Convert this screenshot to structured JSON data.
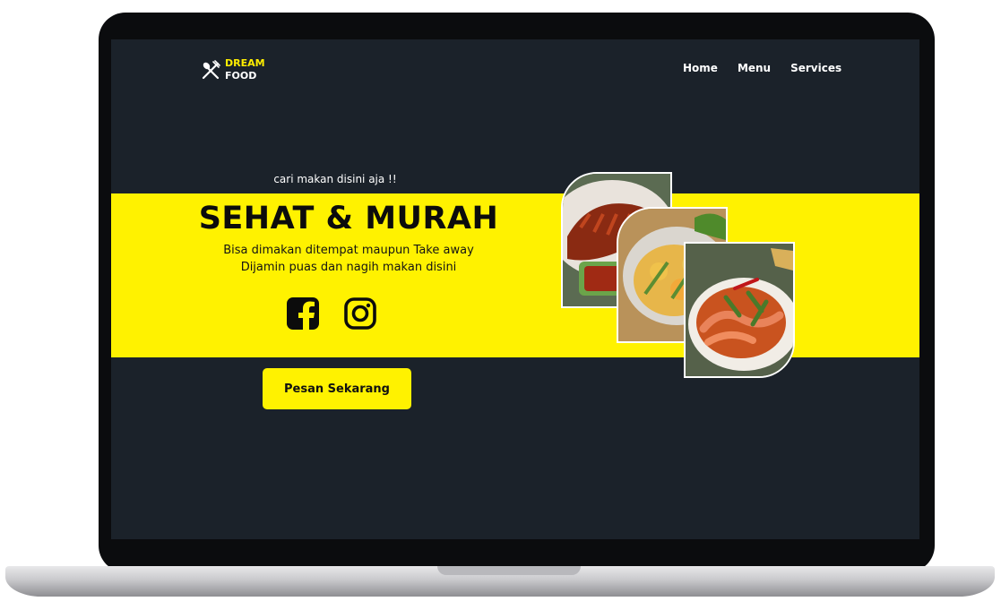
{
  "brand": {
    "line1": "DREAM",
    "line2": "FOOD",
    "icon": "fork-spoon-icon",
    "accent": "#fff200"
  },
  "nav": {
    "items": [
      "Home",
      "Menu",
      "Services"
    ]
  },
  "hero": {
    "tagline": "cari makan disini aja !!",
    "headline": "SEHAT & MURAH",
    "line1": "Bisa dimakan ditempat maupun Take away",
    "line2": "Dijamin puas dan nagih makan disini",
    "cta": "Pesan Sekarang",
    "socials": [
      "facebook-icon",
      "instagram-icon"
    ]
  },
  "colors": {
    "background": "#1b222a",
    "band": "#fff200",
    "text_dark": "#0c0c0c",
    "text_light": "#ffffff"
  }
}
